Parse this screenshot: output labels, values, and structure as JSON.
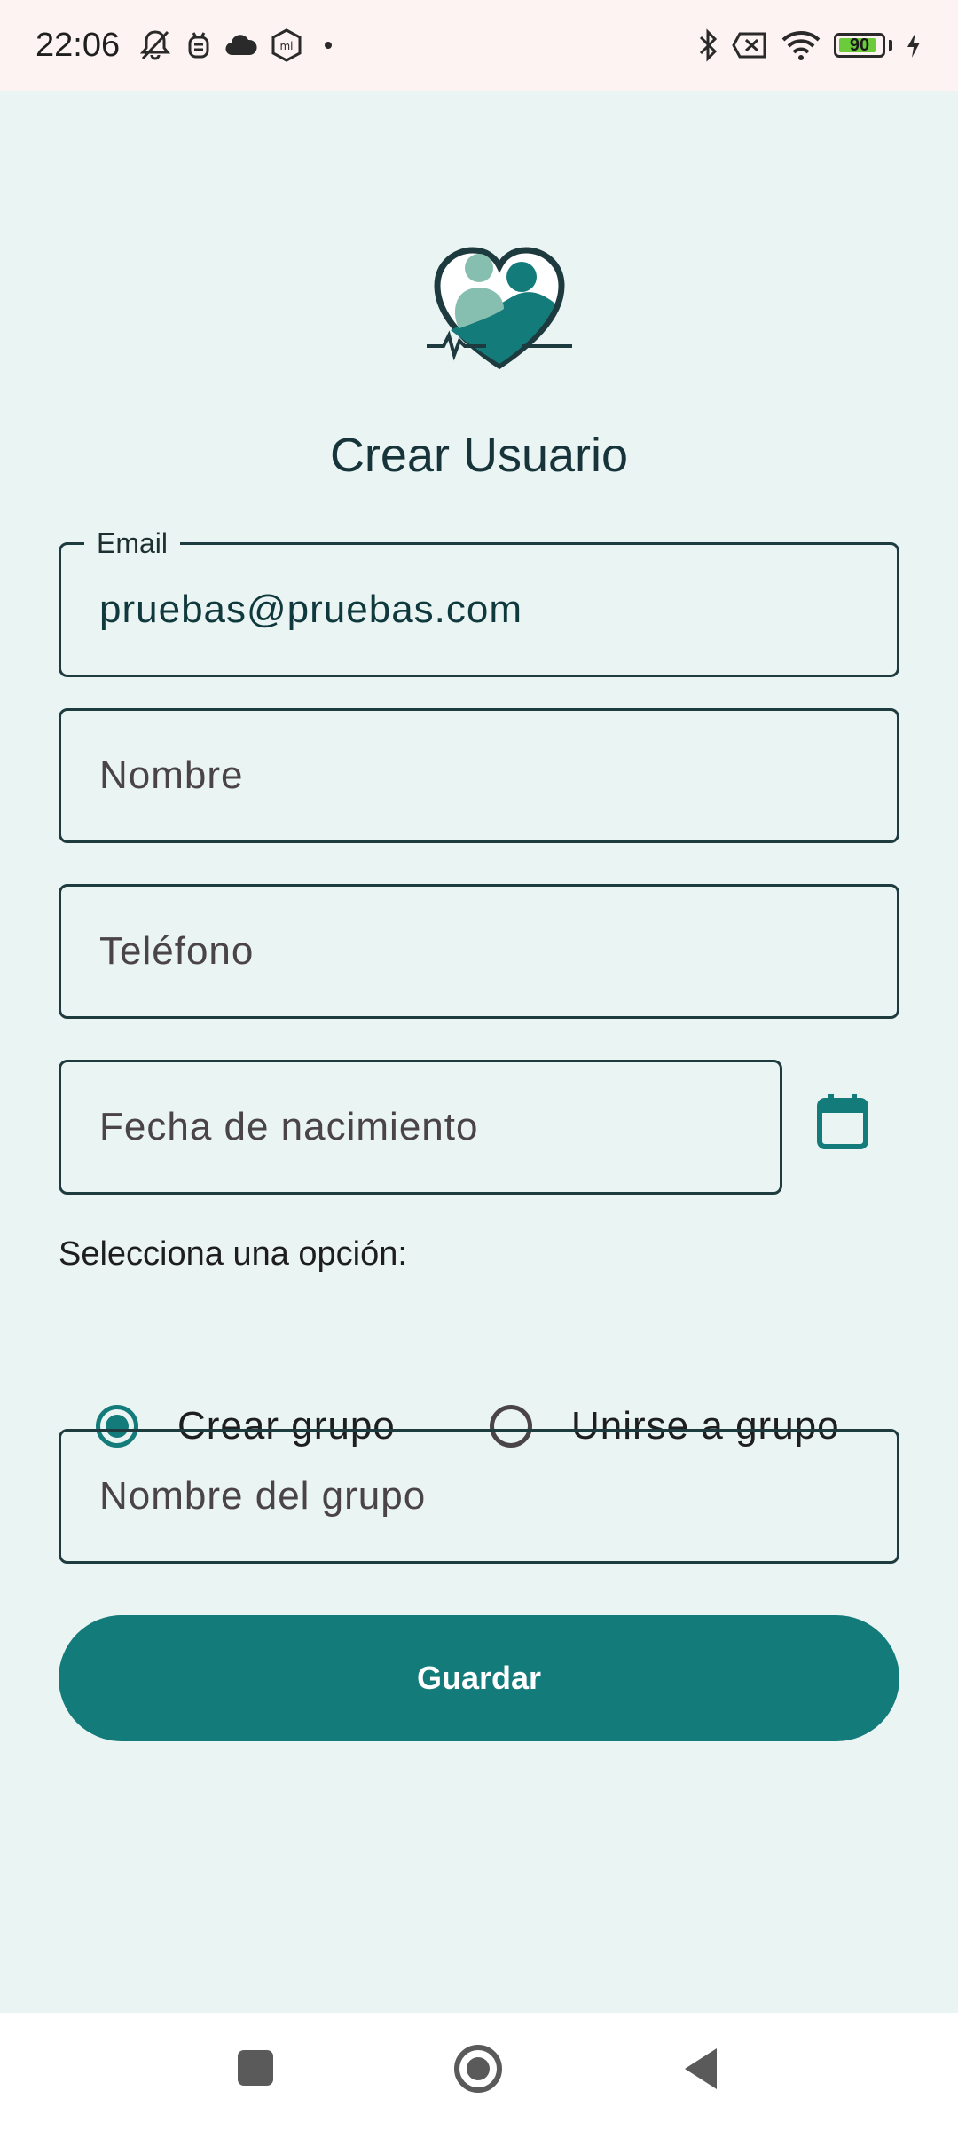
{
  "status_bar": {
    "time": "22:06",
    "battery_level": "90",
    "battery_fraction": 0.9,
    "icons_left": [
      "mute-icon",
      "robot-icon",
      "cloud-icon",
      "mi-icon",
      "dot-icon"
    ],
    "icons_right": [
      "bluetooth-icon",
      "sim-off-icon",
      "wifi-icon",
      "battery-icon",
      "charging-icon"
    ]
  },
  "page": {
    "title": "Crear Usuario"
  },
  "form": {
    "email": {
      "label": "Email",
      "value": "pruebas@pruebas.com"
    },
    "name": {
      "placeholder": "Nombre"
    },
    "phone": {
      "placeholder": "Teléfono"
    },
    "birthdate": {
      "placeholder": "Fecha de nacimiento"
    },
    "option_prompt": "Selecciona una opción:",
    "options": [
      {
        "label": "Crear grupo",
        "selected": true
      },
      {
        "label": "Unirse a grupo",
        "selected": false
      }
    ],
    "group_name": {
      "placeholder": "Nombre del grupo"
    },
    "save_label": "Guardar"
  },
  "colors": {
    "primary": "#137B7A",
    "background": "#E9F4F3",
    "status_bar_bg": "#FDF3F2",
    "text_dark": "#16343A"
  }
}
